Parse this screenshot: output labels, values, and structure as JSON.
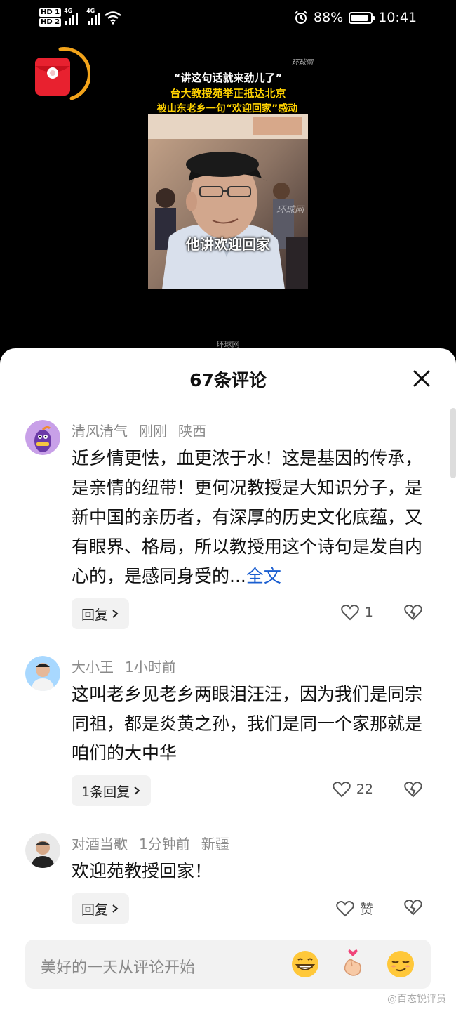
{
  "status_bar": {
    "hd1": "HD 1",
    "hd2": "HD 2",
    "net1": "4G",
    "net2": "4G",
    "battery_percent": "88%",
    "battery_level": 0.88,
    "time": "10:41"
  },
  "video": {
    "watermark_top": "环球网",
    "headline_line1": "“讲这句话就来劲儿了”",
    "headline_line2": "台大教授苑举正抵达北京",
    "headline_line3": "被山东老乡一句“欢迎回家”感动",
    "subtitle": "他讲欢迎回家",
    "frame_watermark": "环球网",
    "watermark_bottom": "环球网"
  },
  "comments_panel": {
    "title": "67条评论",
    "comments": [
      {
        "user": "清风清气",
        "time": "刚刚",
        "location": "陕西",
        "text": "近乡情更怯，血更浓于水！这是基因的传承，是亲情的纽带！更何况教授是大知识分子，是新中国的亲历者，有深厚的历史文化底蕴，又有眼界、格局，所以教授用这个诗句是发自内心的，是感同身受的...",
        "more": "全文",
        "reply_label": "回复",
        "likes": "1"
      },
      {
        "user": "大小王",
        "time": "1小时前",
        "location": "",
        "text": "这叫老乡见老乡两眼泪汪汪，因为我们是同宗同祖，都是炎黄之孙，我们是同一个家那就是咱们的大中华",
        "reply_label": "1条回复",
        "likes": "22"
      },
      {
        "user": "对酒当歌",
        "time": "1分钟前",
        "location": "新疆",
        "text": "欢迎苑教授回家！",
        "reply_label": "回复",
        "likes": "赞"
      }
    ]
  },
  "input": {
    "placeholder": "美好的一天从评论开始"
  },
  "footer": {
    "watermark": "@百态锐评员"
  },
  "colors": {
    "link": "#1a5ed0",
    "headline_yellow": "#ffd200",
    "redpack": "#e8212f"
  }
}
